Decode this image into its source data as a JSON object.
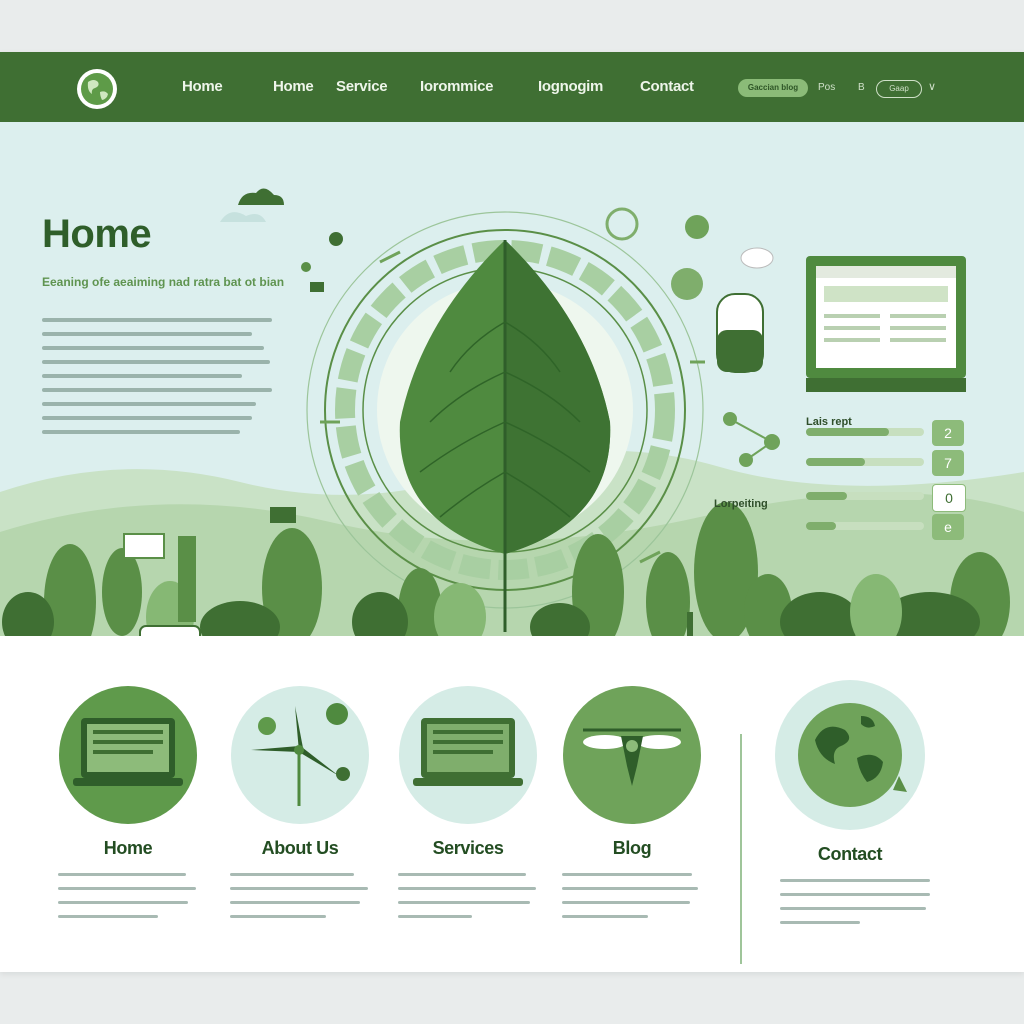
{
  "nav": {
    "links": [
      "Home",
      "Home",
      "Service",
      "Iorommice",
      "Iognogim",
      "Contact"
    ],
    "pill_label": "Gaccian blog",
    "mini_a": "Pos",
    "mini_b": "B",
    "pill2_label": "Gaap",
    "chevron": "∨"
  },
  "hero": {
    "title": "Home",
    "subtitle": "Eeaning ofe aeaiming nad ratra bat ot bian",
    "label_a": "Lais rept",
    "label_b": "Lorpeiting",
    "badges": [
      "2",
      "7",
      "0",
      "e"
    ],
    "meters": [
      0.7,
      0.5,
      0.35,
      0.25
    ]
  },
  "features": [
    {
      "title": "Home",
      "icon": "laptop-icon"
    },
    {
      "title": "About Us",
      "icon": "wind-turbine-icon"
    },
    {
      "title": "Services",
      "icon": "laptop-icon"
    },
    {
      "title": "Blog",
      "icon": "drone-icon"
    },
    {
      "title": "Contact",
      "icon": "globe-icon"
    }
  ],
  "colors": {
    "nav": "#3f6f33",
    "hero_bg": "#dcefee",
    "accent": "#5a8f47",
    "title": "#2f5e2a"
  }
}
